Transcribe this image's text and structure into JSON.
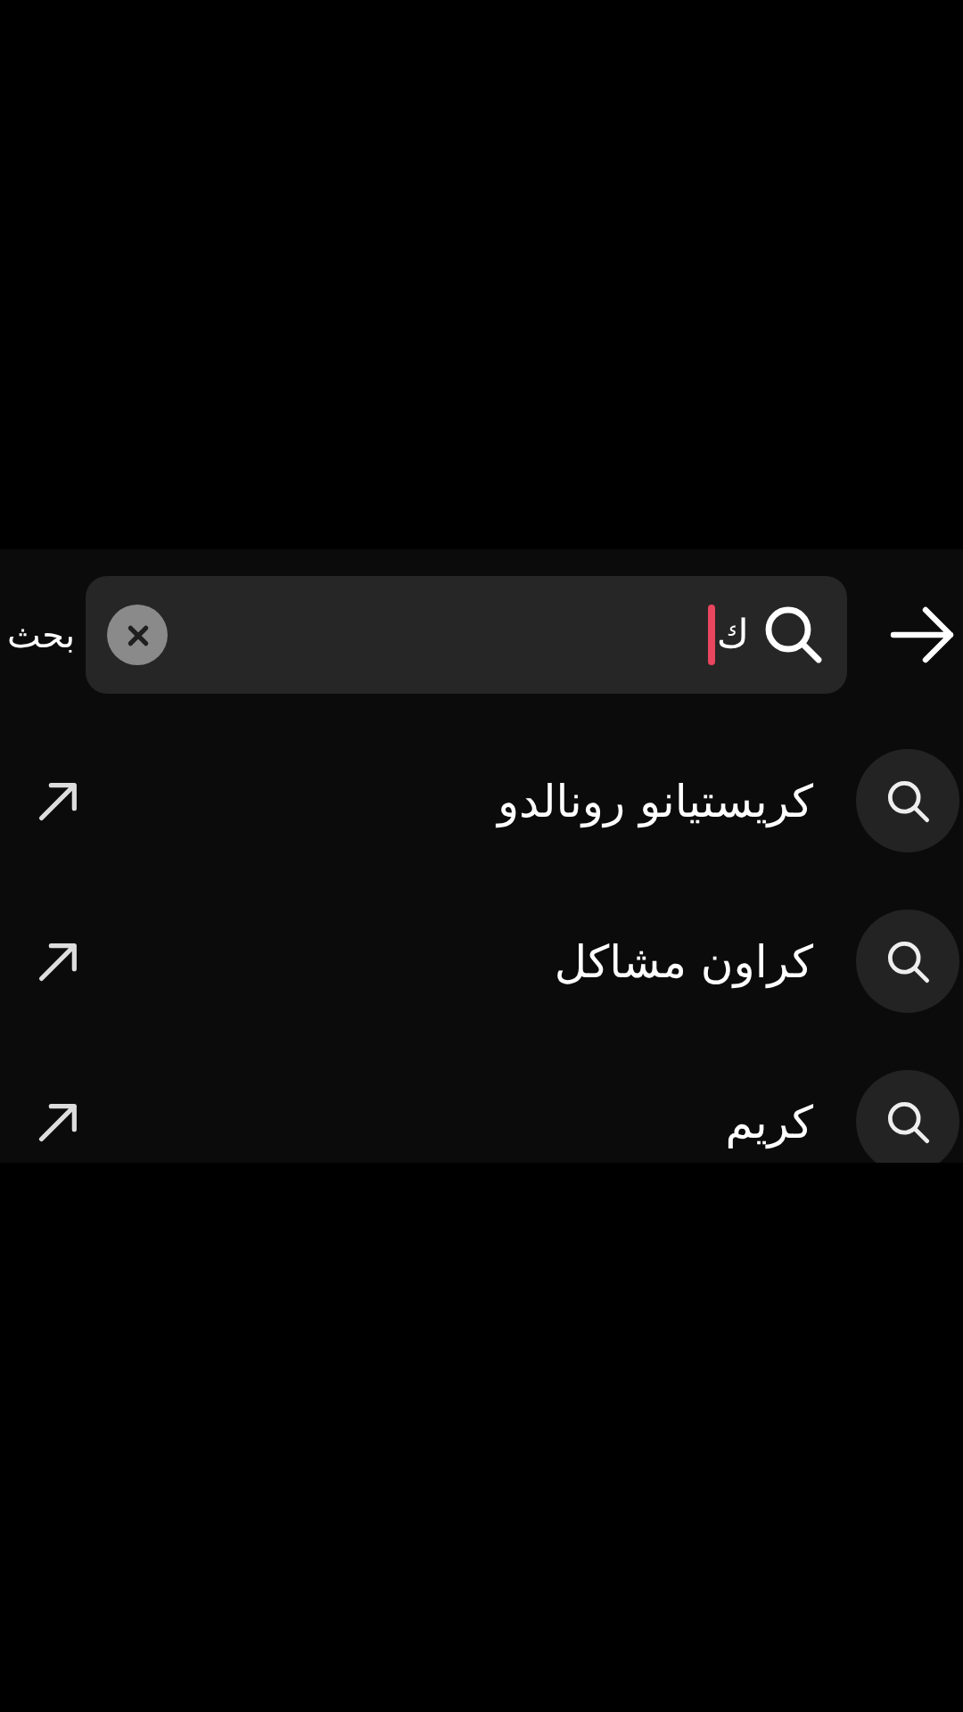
{
  "search": {
    "value": "ك",
    "cancel_label": "بحث"
  },
  "suggestions": [
    {
      "text": "كريستيانو رونالدو"
    },
    {
      "text": "كراون مشاكل"
    },
    {
      "text": "كريم"
    }
  ]
}
